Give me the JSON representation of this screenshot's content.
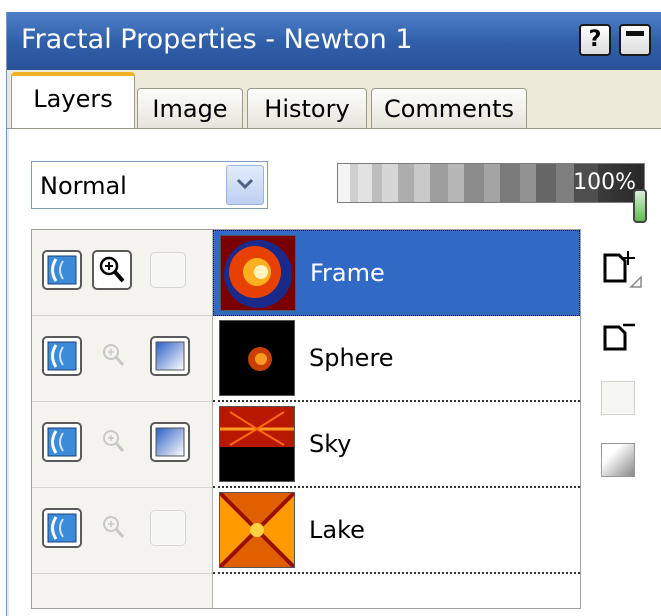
{
  "window": {
    "title": "Fractal Properties - Newton 1",
    "help_button": "?",
    "accent_color": "#316ac5",
    "titlebar_color": "#3a6cb8"
  },
  "tabs": [
    {
      "label": "Layers",
      "active": true
    },
    {
      "label": "Image",
      "active": false
    },
    {
      "label": "History",
      "active": false
    },
    {
      "label": "Comments",
      "active": false
    }
  ],
  "blend_mode": {
    "value": "Normal"
  },
  "opacity": {
    "label": "100%",
    "value": 100
  },
  "layers": [
    {
      "name": "Frame",
      "selected": true,
      "visible": true,
      "zoom_active": true,
      "mask": false
    },
    {
      "name": "Sphere",
      "selected": false,
      "visible": true,
      "zoom_active": false,
      "mask": true
    },
    {
      "name": "Sky",
      "selected": false,
      "visible": true,
      "zoom_active": false,
      "mask": true
    },
    {
      "name": "Lake",
      "selected": false,
      "visible": true,
      "zoom_active": false,
      "mask": false
    }
  ],
  "side_buttons": [
    {
      "icon": "new-layer-icon"
    },
    {
      "icon": "delete-layer-icon"
    },
    {
      "icon": "layer-properties-icon"
    },
    {
      "icon": "merge-layer-icon"
    }
  ]
}
